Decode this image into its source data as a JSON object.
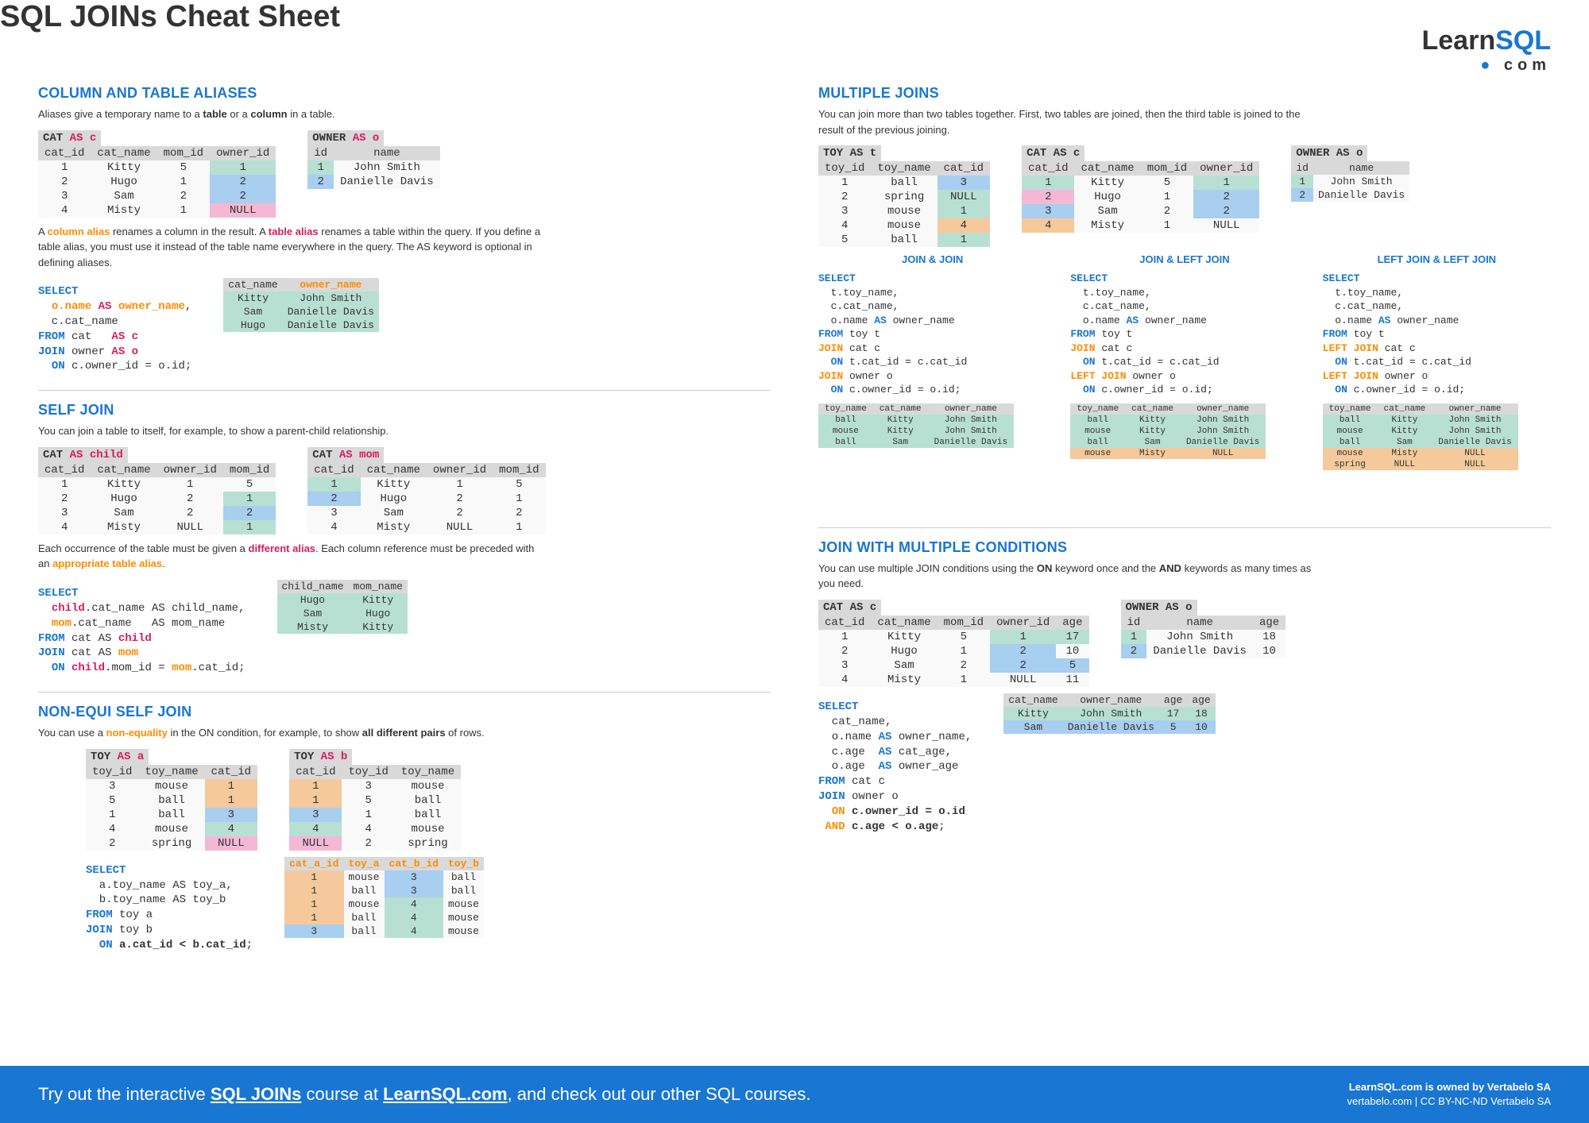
{
  "title": "SQL JOINs Cheat Sheet",
  "logo": {
    "main1": "Learn",
    "main2": "SQL",
    "sub": "com"
  },
  "aliases": {
    "heading": "COLUMN AND TABLE ALIASES",
    "desc1_a": "Aliases give a temporary name to a ",
    "desc1_b": "table",
    "desc1_c": " or a ",
    "desc1_d": "column",
    "desc1_e": " in a table.",
    "cat_label": "CAT",
    "cat_alias": " AS c",
    "owner_label": "OWNER",
    "owner_alias": " AS o",
    "cat_table": {
      "headers": [
        "cat_id",
        "cat_name",
        "mom_id",
        "owner_id"
      ],
      "rows": [
        [
          "1",
          "Kitty",
          "5",
          "1"
        ],
        [
          "2",
          "Hugo",
          "1",
          "2"
        ],
        [
          "3",
          "Sam",
          "2",
          "2"
        ],
        [
          "4",
          "Misty",
          "1",
          "NULL"
        ]
      ],
      "ownerCol": [
        "bg-green",
        "bg-blue",
        "bg-blue",
        "bg-pink"
      ]
    },
    "owner_table": {
      "headers": [
        "id",
        "name"
      ],
      "rows": [
        [
          "1",
          "John Smith"
        ],
        [
          "2",
          "Danielle Davis"
        ]
      ],
      "idCol": [
        "bg-green",
        "bg-blue"
      ]
    },
    "desc2_parts": [
      "A ",
      "column alias",
      " renames a column in the result. A ",
      "table alias",
      " renames a table within the query. If you define a table alias, you must use it instead of the table name everywhere in the query. The AS keyword is optional in defining aliases."
    ],
    "code1": "SELECT\n  o.name AS owner_name,\n  c.cat_name\nFROM cat   AS c\nJOIN owner AS o\n  ON c.owner_id = o.id;",
    "result1": {
      "headers": [
        "cat_name",
        "owner_name"
      ],
      "rows": [
        [
          "Kitty",
          "John Smith"
        ],
        [
          "Sam",
          "Danielle Davis"
        ],
        [
          "Hugo",
          "Danielle Davis"
        ]
      ]
    }
  },
  "selfjoin": {
    "heading": "SELF JOIN",
    "desc1": "You can join a table to itself, for example, to show a parent-child relationship.",
    "child_label": "CAT",
    "child_alias": " AS child",
    "mom_label": "CAT",
    "mom_alias": " AS mom",
    "child_table": {
      "headers": [
        "cat_id",
        "cat_name",
        "owner_id",
        "mom_id"
      ],
      "rows": [
        [
          "1",
          "Kitty",
          "1",
          "5"
        ],
        [
          "2",
          "Hugo",
          "2",
          "1"
        ],
        [
          "3",
          "Sam",
          "2",
          "2"
        ],
        [
          "4",
          "Misty",
          "NULL",
          "1"
        ]
      ],
      "momCol": [
        "",
        "bg-green",
        "bg-blue",
        "bg-green"
      ]
    },
    "mom_table": {
      "headers": [
        "cat_id",
        "cat_name",
        "owner_id",
        "mom_id"
      ],
      "rows": [
        [
          "1",
          "Kitty",
          "1",
          "5"
        ],
        [
          "2",
          "Hugo",
          "2",
          "1"
        ],
        [
          "3",
          "Sam",
          "2",
          "2"
        ],
        [
          "4",
          "Misty",
          "NULL",
          "1"
        ]
      ],
      "catIdCol": [
        "bg-green",
        "bg-blue",
        "",
        ""
      ]
    },
    "desc2_parts": [
      "Each occurrence of the table must be given a ",
      "different alias",
      ". Each column reference must be preceded with an ",
      "appropriate table alias",
      "."
    ],
    "code": "SELECT\n  child.cat_name AS child_name,\n  mom.cat_name   AS mom_name\nFROM cat AS child\nJOIN cat AS mom\n  ON child.mom_id = mom.cat_id;",
    "result": {
      "headers": [
        "child_name",
        "mom_name"
      ],
      "rows": [
        [
          "Hugo",
          "Kitty"
        ],
        [
          "Sam",
          "Hugo"
        ],
        [
          "Misty",
          "Kitty"
        ]
      ]
    }
  },
  "nonequi": {
    "heading": "NON-EQUI SELF JOIN",
    "desc_parts": [
      "You can use a ",
      "non-equality",
      " in the ON condition, for example, to show ",
      "all different pairs",
      " of rows."
    ],
    "a_label": "TOY",
    "a_alias": " AS a",
    "b_label": "TOY",
    "b_alias": " AS b",
    "a_table": {
      "headers": [
        "toy_id",
        "toy_name",
        "cat_id"
      ],
      "rows": [
        [
          "3",
          "mouse",
          "1"
        ],
        [
          "5",
          "ball",
          "1"
        ],
        [
          "1",
          "ball",
          "3"
        ],
        [
          "4",
          "mouse",
          "4"
        ],
        [
          "2",
          "spring",
          "NULL"
        ]
      ],
      "catIdCol": [
        "bg-orange",
        "bg-orange",
        "bg-blue",
        "bg-green",
        "bg-pink"
      ]
    },
    "b_table": {
      "headers": [
        "cat_id",
        "toy_id",
        "toy_name"
      ],
      "rows": [
        [
          "1",
          "3",
          "mouse"
        ],
        [
          "1",
          "5",
          "ball"
        ],
        [
          "3",
          "1",
          "ball"
        ],
        [
          "4",
          "4",
          "mouse"
        ],
        [
          "NULL",
          "2",
          "spring"
        ]
      ],
      "catIdCol": [
        "bg-orange",
        "bg-orange",
        "bg-blue",
        "bg-green",
        "bg-pink"
      ]
    },
    "code": "SELECT\n  a.toy_name AS toy_a,\n  b.toy_name AS toy_b\nFROM toy a\nJOIN toy b\n  ON a.cat_id < b.cat_id;",
    "result": {
      "headers": [
        "cat_a_id",
        "toy_a",
        "cat_b_id",
        "toy_b"
      ],
      "rows": [
        [
          "1",
          "mouse",
          "3",
          "ball"
        ],
        [
          "1",
          "ball",
          "3",
          "ball"
        ],
        [
          "1",
          "mouse",
          "4",
          "mouse"
        ],
        [
          "1",
          "ball",
          "4",
          "mouse"
        ],
        [
          "3",
          "ball",
          "4",
          "mouse"
        ]
      ],
      "aCol": [
        "bg-orange",
        "bg-orange",
        "bg-orange",
        "bg-orange",
        "bg-blue"
      ],
      "bCol": [
        "bg-blue",
        "bg-blue",
        "bg-green",
        "bg-green",
        "bg-green"
      ]
    }
  },
  "multiple": {
    "heading": "MULTIPLE JOINS",
    "desc": "You can join more than two tables together.  First, two tables are joined, then the third table is joined to the result of the previous joining.",
    "toy_label": "TOY AS t",
    "cat_label": "CAT AS c",
    "owner_label": "OWNER AS o",
    "toy_table": {
      "headers": [
        "toy_id",
        "toy_name",
        "cat_id"
      ],
      "rows": [
        [
          "1",
          "ball",
          "3"
        ],
        [
          "2",
          "spring",
          "NULL"
        ],
        [
          "3",
          "mouse",
          "1"
        ],
        [
          "4",
          "mouse",
          "4"
        ],
        [
          "5",
          "ball",
          "1"
        ]
      ],
      "catCol": [
        "bg-blue",
        "bg-green",
        "bg-green",
        "bg-orange",
        "bg-green"
      ]
    },
    "cat_table": {
      "headers": [
        "cat_id",
        "cat_name",
        "mom_id",
        "owner_id"
      ],
      "rows": [
        [
          "1",
          "Kitty",
          "5",
          "1"
        ],
        [
          "2",
          "Hugo",
          "1",
          "2"
        ],
        [
          "3",
          "Sam",
          "2",
          "2"
        ],
        [
          "4",
          "Misty",
          "1",
          "NULL"
        ]
      ],
      "idCol": [
        "bg-green",
        "bg-pink",
        "bg-blue",
        "bg-orange"
      ],
      "ownerCol": [
        "bg-green",
        "bg-blue",
        "bg-blue",
        ""
      ]
    },
    "owner_table": {
      "headers": [
        "id",
        "name"
      ],
      "rows": [
        [
          "1",
          "John Smith"
        ],
        [
          "2",
          "Danielle Davis"
        ]
      ],
      "idCol": [
        "bg-green",
        "bg-blue"
      ]
    },
    "variants": [
      {
        "title": "JOIN & JOIN",
        "code": "SELECT\n  t.toy_name,\n  c.cat_name,\n  o.name AS owner_name\nFROM toy t\nJOIN cat c\n  ON t.cat_id = c.cat_id\nJOIN owner o\n  ON c.owner_id = o.id;",
        "kw1": "JOIN",
        "kw2": "JOIN",
        "result": {
          "headers": [
            "toy_name",
            "cat_name",
            "owner_name"
          ],
          "rows": [
            [
              "ball",
              "Kitty",
              "John Smith"
            ],
            [
              "mouse",
              "Kitty",
              "John Smith"
            ],
            [
              "ball",
              "Sam",
              "Danielle Davis"
            ]
          ]
        }
      },
      {
        "title": "JOIN & LEFT JOIN",
        "code": "SELECT\n  t.toy_name,\n  c.cat_name,\n  o.name AS owner_name\nFROM toy t\nJOIN cat c\n  ON t.cat_id = c.cat_id\nLEFT JOIN owner o\n  ON c.owner_id = o.id;",
        "kw1": "JOIN",
        "kw2": "LEFT JOIN",
        "result": {
          "headers": [
            "toy_name",
            "cat_name",
            "owner_name"
          ],
          "rows": [
            [
              "ball",
              "Kitty",
              "John Smith"
            ],
            [
              "mouse",
              "Kitty",
              "John Smith"
            ],
            [
              "ball",
              "Sam",
              "Danielle Davis"
            ],
            [
              "mouse",
              "Misty",
              "NULL"
            ]
          ],
          "nullRows": [
            3
          ]
        }
      },
      {
        "title": "LEFT JOIN & LEFT JOIN",
        "code": "SELECT\n  t.toy_name,\n  c.cat_name,\n  o.name AS owner_name\nFROM toy t\nLEFT JOIN cat c\n  ON t.cat_id = c.cat_id\nLEFT JOIN owner o\n  ON c.owner_id = o.id;",
        "kw1": "LEFT JOIN",
        "kw2": "LEFT JOIN",
        "result": {
          "headers": [
            "toy_name",
            "cat_name",
            "owner_name"
          ],
          "rows": [
            [
              "ball",
              "Kitty",
              "John Smith"
            ],
            [
              "mouse",
              "Kitty",
              "John Smith"
            ],
            [
              "ball",
              "Sam",
              "Danielle Davis"
            ],
            [
              "mouse",
              "Misty",
              "NULL"
            ],
            [
              "spring",
              "NULL",
              "NULL"
            ]
          ],
          "nullRows": [
            3,
            4
          ]
        }
      }
    ]
  },
  "multicond": {
    "heading": "JOIN WITH MULTIPLE CONDITIONS",
    "desc_parts": [
      "You can use multiple JOIN conditions using the ",
      "ON",
      " keyword once and the ",
      "AND",
      " keywords as many times as you need."
    ],
    "cat_label": "CAT AS c",
    "owner_label": "OWNER AS o",
    "cat_table": {
      "headers": [
        "cat_id",
        "cat_name",
        "mom_id",
        "owner_id",
        "age"
      ],
      "rows": [
        [
          "1",
          "Kitty",
          "5",
          "1",
          "17"
        ],
        [
          "2",
          "Hugo",
          "1",
          "2",
          "10"
        ],
        [
          "3",
          "Sam",
          "2",
          "2",
          "5"
        ],
        [
          "4",
          "Misty",
          "1",
          "NULL",
          "11"
        ]
      ],
      "ownerCol": [
        "bg-green",
        "bg-blue",
        "bg-blue",
        ""
      ],
      "ageCol": [
        "bg-green",
        "",
        "bg-blue",
        ""
      ]
    },
    "owner_table": {
      "headers": [
        "id",
        "name",
        "age"
      ],
      "rows": [
        [
          "1",
          "John Smith",
          "18"
        ],
        [
          "2",
          "Danielle Davis",
          "10"
        ]
      ],
      "idCol": [
        "bg-green",
        "bg-blue"
      ]
    },
    "code": "SELECT\n  cat_name,\n  o.name AS owner_name,\n  c.age  AS cat_age,\n  o.age  AS owner_age\nFROM cat c\nJOIN owner o\n  ON c.owner_id = o.id\n AND c.age < o.age;",
    "result": {
      "headers": [
        "cat_name",
        "owner_name",
        "age",
        "age"
      ],
      "rows": [
        [
          "Kitty",
          "John Smith",
          "17",
          "18"
        ],
        [
          "Sam",
          "Danielle Davis",
          "5",
          "10"
        ]
      ],
      "ageCol": [
        "bg-green",
        "bg-blue"
      ]
    }
  },
  "footer": {
    "left_parts": [
      "Try out the interactive ",
      "SQL JOINs",
      " course at ",
      "LearnSQL.com",
      ", and check out our other SQL courses."
    ],
    "right1": "LearnSQL.com is owned by Vertabelo SA",
    "right2": "vertabelo.com | CC BY-NC-ND Vertabelo SA"
  }
}
